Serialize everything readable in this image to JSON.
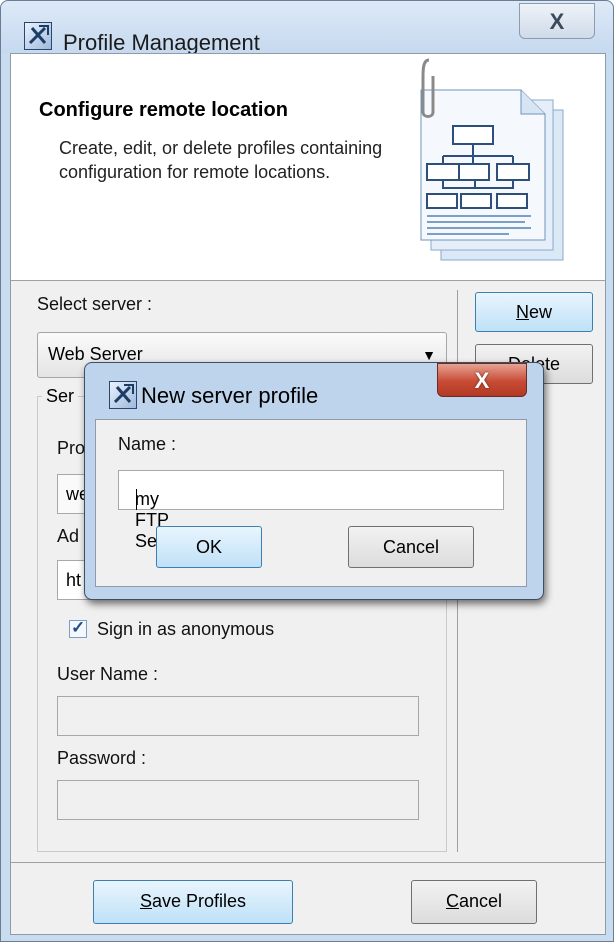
{
  "window": {
    "title": "Profile Management",
    "close_glyph": "X",
    "icon": "profile-management-icon"
  },
  "header": {
    "title": "Configure remote location",
    "description": "Create, edit, or delete profiles containing configuration for remote locations.",
    "illustration_icon": "document-diagram-icon"
  },
  "server": {
    "select_label": "Select server :",
    "selected_value": "Web Server",
    "new_button": "New",
    "delete_button": "Delete"
  },
  "settings_group": {
    "legend": "Ser",
    "protocol_label": "Pro",
    "protocol_value": "we",
    "address_label": "Ad",
    "address_value": "ht",
    "anonymous_label": "Sign in as anonymous",
    "anonymous_checked": true,
    "username_label": "User Name :",
    "username_value": "",
    "password_label": "Password :",
    "password_value": ""
  },
  "footer": {
    "save_button": "Save Profiles",
    "cancel_button": "Cancel"
  },
  "dialog": {
    "title": "New server profile",
    "close_glyph": "X",
    "name_label": "Name :",
    "name_value": "my FTP Server",
    "ok_button": "OK",
    "cancel_button": "Cancel"
  }
}
